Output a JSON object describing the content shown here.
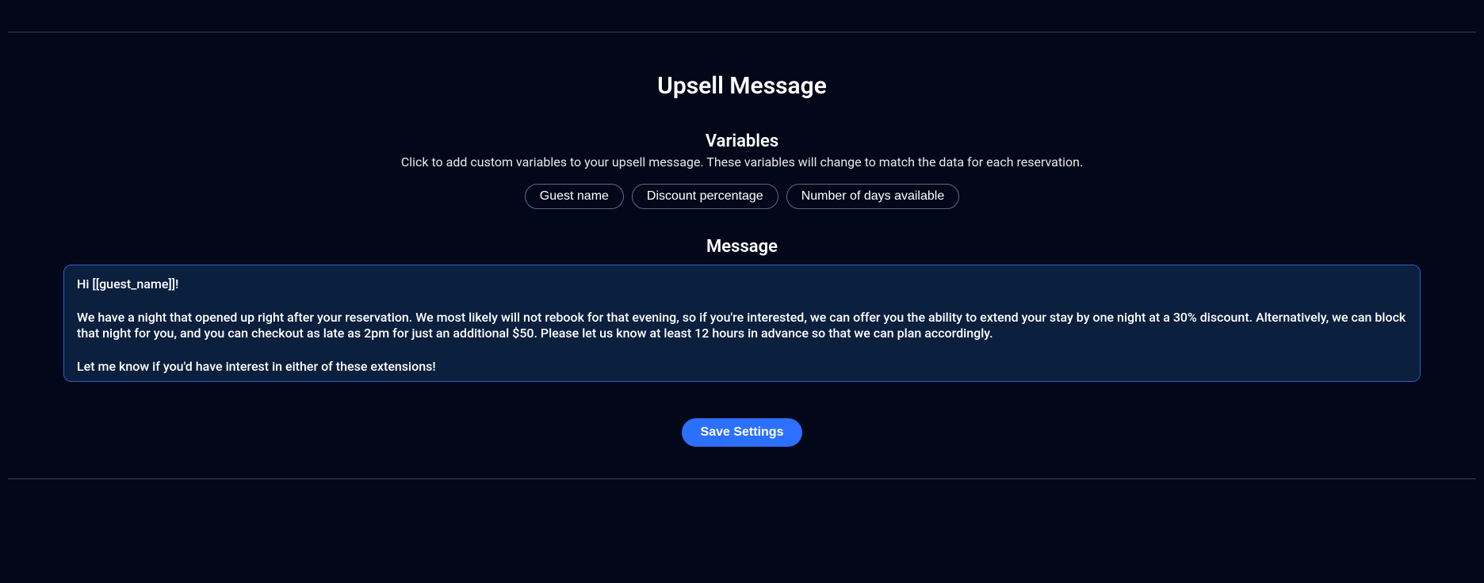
{
  "section": {
    "title": "Upsell Message"
  },
  "variables": {
    "title": "Variables",
    "subtitle": "Click to add custom variables to your upsell message. These variables will change to match the data for each reservation.",
    "chips": [
      {
        "label": "Guest name"
      },
      {
        "label": "Discount percentage"
      },
      {
        "label": "Number of days available"
      }
    ]
  },
  "message": {
    "title": "Message",
    "content": "Hi [[guest_name]]!\n\nWe have a night that opened up right after your reservation. We most likely will not rebook for that evening, so if you're interested, we can offer you the ability to extend your stay by one night at a 30% discount. Alternatively, we can block that night for you, and you can checkout as late as 2pm for just an additional $50. Please let us know at least 12 hours in advance so that we can plan accordingly.\n\nLet me know if you'd have interest in either of these extensions!"
  },
  "actions": {
    "save_label": "Save Settings"
  }
}
